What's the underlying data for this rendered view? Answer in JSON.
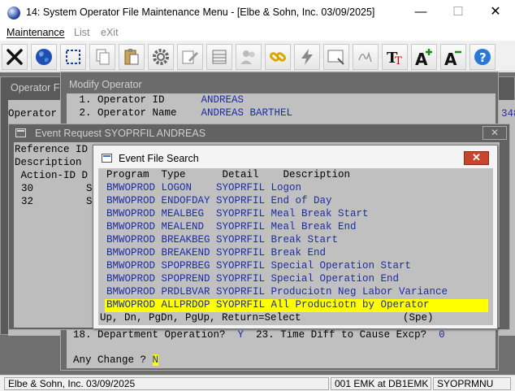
{
  "window": {
    "title": "14: System Operator File Maintenance Menu - [Elbe & Sohn, Inc. 03/09/2025]",
    "minimize": "—",
    "maximize": "☐",
    "close": "✕"
  },
  "menu": {
    "items": [
      "Maintenance",
      "List",
      "eXit"
    ]
  },
  "toolbar": {
    "icons": [
      "close-x-icon",
      "globe-icon",
      "select-icon",
      "copy-icon",
      "paste-icon",
      "settings-icon",
      "edit-icon",
      "grid-icon",
      "users-icon",
      "link-icon",
      "lightning-icon",
      "window-icon",
      "signature-icon",
      "text-format-icon",
      "font-increase-icon",
      "font-decrease-icon",
      "help-icon"
    ]
  },
  "operator_file": {
    "title": "Operator Fi",
    "label": "Operator",
    "fragment": "348"
  },
  "modify_operator": {
    "title": "Modify Operator",
    "line1_label": " 1. Operator ID      ",
    "line1_value": "ANDREAS",
    "line2_label": " 2. Operator Name    ",
    "line2_value": "ANDREAS BARTHEL",
    "line18_label": "18. Department Operation?  ",
    "line18_value": "Y",
    "line23_label": "  23. Time Diff to Cause Excp?  ",
    "line23_value": "0",
    "prompt_label": "Any Change ? ",
    "prompt_value": "N"
  },
  "event_request": {
    "title": "Event Request SYOPRFIL ANDREAS",
    "close": "✕",
    "reference_label": "Reference ID",
    "description_label": "Description",
    "column_header": " Action-ID D",
    "rows": [
      {
        "id": "30",
        "col": "S"
      },
      {
        "id": "32",
        "col": "S"
      }
    ]
  },
  "event_file_search": {
    "title": "Event File Search",
    "close": "✕",
    "header": "Program  Type      Detail    Description",
    "rows": [
      {
        "program": "BMWOPROD",
        "type": "LOGON",
        "detail": "SYOPRFIL",
        "description": "Logon"
      },
      {
        "program": "BMWOPROD",
        "type": "ENDOFDAY",
        "detail": "SYOPRFIL",
        "description": "End of Day"
      },
      {
        "program": "BMWOPROD",
        "type": "MEALBEG",
        "detail": "SYOPRFIL",
        "description": "Meal Break Start"
      },
      {
        "program": "BMWOPROD",
        "type": "MEALEND",
        "detail": "SYOPRFIL",
        "description": "Meal Break End"
      },
      {
        "program": "BMWOPROD",
        "type": "BREAKBEG",
        "detail": "SYOPRFIL",
        "description": "Break Start"
      },
      {
        "program": "BMWOPROD",
        "type": "BREAKEND",
        "detail": "SYOPRFIL",
        "description": "Break End"
      },
      {
        "program": "BMWOPROD",
        "type": "SPOPRBEG",
        "detail": "SYOPRFIL",
        "description": "Special Operation Start"
      },
      {
        "program": "BMWOPROD",
        "type": "SPOPREND",
        "detail": "SYOPRFIL",
        "description": "Special Operation End"
      },
      {
        "program": "BMWOPROD",
        "type": "PRDLBVAR",
        "detail": "SYOPRFIL",
        "description": "Produciotn Neg Labor Variance"
      },
      {
        "program": "BMWOPROD",
        "type": "ALLPRDOP",
        "detail": "SYOPRFIL",
        "description": "All Produciotn by Operator"
      }
    ],
    "selected_index": 9,
    "footer": "Up, Dn, PgDn, PgUp, Return=Select",
    "footer_right": "(Spe)"
  },
  "status_bar": {
    "company": "Elbe & Sohn, Inc. 03/09/2025",
    "user": "001 EMK at DB1EMK",
    "program": "SYOPRMNU"
  }
}
